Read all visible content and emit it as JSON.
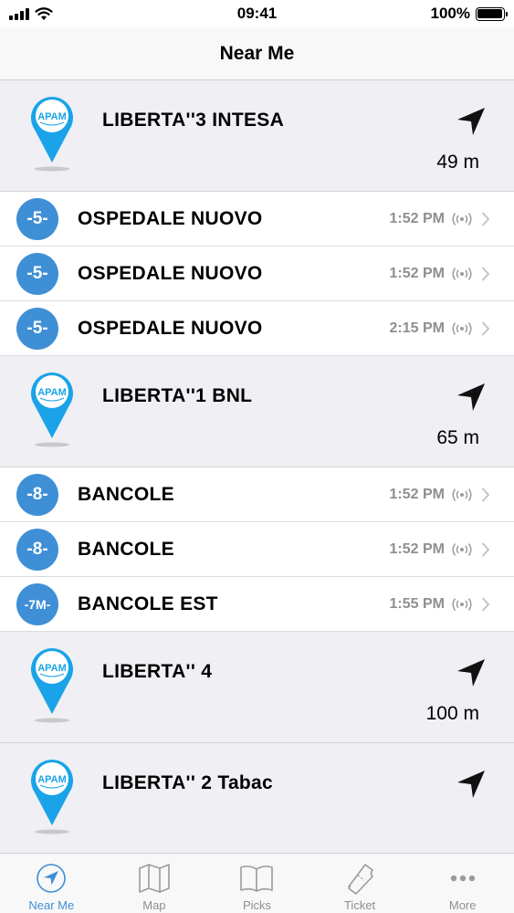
{
  "status_bar": {
    "time": "09:41",
    "battery_text": "100%",
    "battery_level": 1.0
  },
  "nav": {
    "title": "Near Me"
  },
  "colors": {
    "accent": "#3f8fd6",
    "pin_blue": "#1aa3e8",
    "header_bg": "#efeff4",
    "secondary_text": "#8e8e93"
  },
  "stops": [
    {
      "name": "LIBERTA''3 INTESA",
      "distance": "49 m",
      "pin_logo": "APAM",
      "routes": [
        {
          "line": "-5-",
          "destination": "OSPEDALE NUOVO",
          "time": "1:52 PM"
        },
        {
          "line": "-5-",
          "destination": "OSPEDALE NUOVO",
          "time": "1:52 PM"
        },
        {
          "line": "-5-",
          "destination": "OSPEDALE NUOVO",
          "time": "2:15 PM"
        }
      ]
    },
    {
      "name": "LIBERTA''1 BNL",
      "distance": "65 m",
      "pin_logo": "APAM",
      "routes": [
        {
          "line": "-8-",
          "destination": "BANCOLE",
          "time": "1:52 PM"
        },
        {
          "line": "-8-",
          "destination": "BANCOLE",
          "time": "1:52 PM"
        },
        {
          "line": "-7M-",
          "destination": "BANCOLE EST",
          "time": "1:55 PM"
        }
      ]
    },
    {
      "name": "LIBERTA'' 4",
      "distance": "100 m",
      "pin_logo": "APAM",
      "routes": []
    },
    {
      "name": "LIBERTA'' 2 Tabac",
      "distance": "",
      "pin_logo": "APAM",
      "routes": []
    }
  ],
  "tabs": [
    {
      "label": "Near Me",
      "icon": "location-arrow-icon",
      "active": true
    },
    {
      "label": "Map",
      "icon": "map-icon",
      "active": false
    },
    {
      "label": "Picks",
      "icon": "book-icon",
      "active": false
    },
    {
      "label": "Ticket",
      "icon": "ticket-icon",
      "active": false
    },
    {
      "label": "More",
      "icon": "more-dots-icon",
      "active": false
    }
  ]
}
